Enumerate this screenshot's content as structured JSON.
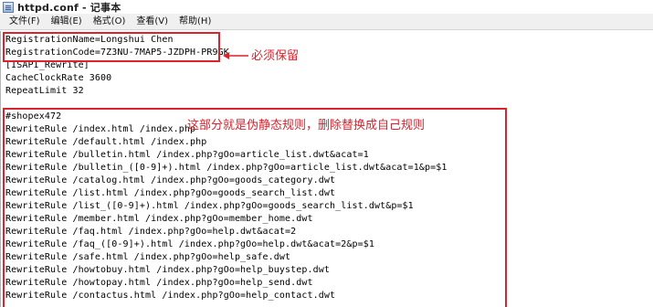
{
  "window": {
    "title": "httpd.conf - 记事本"
  },
  "menu": [
    {
      "label": "文件(F)"
    },
    {
      "label": "编辑(E)"
    },
    {
      "label": "格式(O)"
    },
    {
      "label": "查看(V)"
    },
    {
      "label": "帮助(H)"
    }
  ],
  "document": {
    "lines": [
      "RegistrationName=Longshui Chen",
      "RegistrationCode=7Z3NU-7MAP5-JZDPH-PR9GK",
      "[ISAPI_Rewrite]",
      "CacheClockRate 3600",
      "RepeatLimit 32",
      "",
      "#shopex472",
      "RewriteRule /index.html /index.php",
      "RewriteRule /default.html /index.php",
      "RewriteRule /bulletin.html /index.php?gOo=article_list.dwt&acat=1",
      "RewriteRule /bulletin_([0-9]+).html /index.php?gOo=article_list.dwt&acat=1&p=$1",
      "RewriteRule /catalog.html /index.php?gOo=goods_category.dwt",
      "RewriteRule /list.html /index.php?gOo=goods_search_list.dwt",
      "RewriteRule /list_([0-9]+).html /index.php?gOo=goods_search_list.dwt&p=$1",
      "RewriteRule /member.html /index.php?gOo=member_home.dwt",
      "RewriteRule /faq.html /index.php?gOo=help.dwt&acat=2",
      "RewriteRule /faq_([0-9]+).html /index.php?gOo=help.dwt&acat=2&p=$1",
      "RewriteRule /safe.html /index.php?gOo=help_safe.dwt",
      "RewriteRule /howtobuy.html /index.php?gOo=help_buystep.dwt",
      "RewriteRule /howtopay.html /index.php?gOo=help_send.dwt",
      "RewriteRule /contactus.html /index.php?gOo=help_contact.dwt"
    ]
  },
  "annotations": {
    "keep_note": "必须保留",
    "rules_note": "这部分就是伪静态规则，删除替换成自己规则",
    "color": "#d9232d"
  }
}
